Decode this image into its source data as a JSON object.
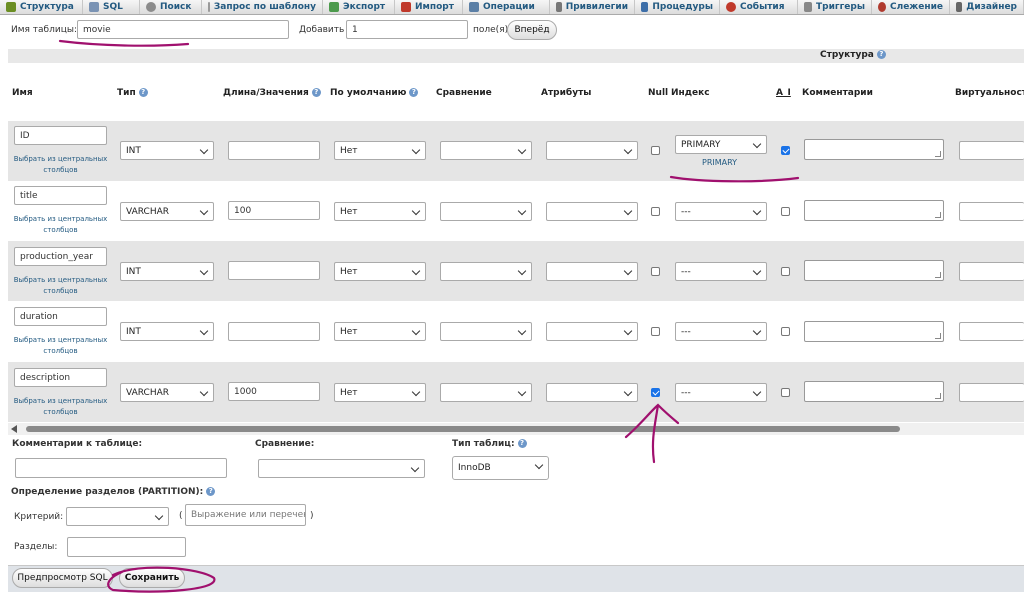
{
  "tabs": [
    {
      "label": "Структура",
      "icon": "structure-icon",
      "color": "#6b8e23"
    },
    {
      "label": "SQL",
      "icon": "sql-icon",
      "color": "#7a93b4"
    },
    {
      "label": "Поиск",
      "icon": "search-icon",
      "color": "#8c8c8c"
    },
    {
      "label": "Запрос по шаблону",
      "icon": "query-icon",
      "color": "#9a9a9a"
    },
    {
      "label": "Экспорт",
      "icon": "export-icon",
      "color": "#4c9a4c"
    },
    {
      "label": "Импорт",
      "icon": "import-icon",
      "color": "#c0392b"
    },
    {
      "label": "Операции",
      "icon": "operations-icon",
      "color": "#5b7fa6"
    },
    {
      "label": "Привилегии",
      "icon": "privileges-icon",
      "color": "#777777"
    },
    {
      "label": "Процедуры",
      "icon": "procedures-icon",
      "color": "#3d6ea8"
    },
    {
      "label": "События",
      "icon": "events-icon",
      "color": "#c0392b"
    },
    {
      "label": "Триггеры",
      "icon": "triggers-icon",
      "color": "#888888"
    },
    {
      "label": "Слежение",
      "icon": "tracking-icon",
      "color": "#b03a2e"
    },
    {
      "label": "Дизайнер",
      "icon": "designer-icon",
      "color": "#666666"
    }
  ],
  "header": {
    "table_name_label": "Имя таблицы:",
    "table_name_value": "movie",
    "add_label": "Добавить",
    "add_count": "1",
    "fields_label": "поле(я)",
    "go_button": "Вперёд"
  },
  "structure_caption": "Структура",
  "columns": {
    "name": "Имя",
    "type": "Тип",
    "length": "Длина/Значения",
    "default": "По умолчанию",
    "collation": "Сравнение",
    "attributes": "Атрибуты",
    "null": "Null",
    "index": "Индекс",
    "ai": "A_I",
    "comments": "Комментарии",
    "virtuality": "Виртуальность"
  },
  "pick_central": "Выбрать из центральных",
  "pick_central_2": "столбцов",
  "rows": [
    {
      "name": "ID",
      "type": "INT",
      "length": "",
      "default": "Нет",
      "null": false,
      "index": "PRIMARY",
      "index_note": "PRIMARY",
      "ai": true
    },
    {
      "name": "title",
      "type": "VARCHAR",
      "length": "100",
      "default": "Нет",
      "null": false,
      "index": "---",
      "index_note": "",
      "ai": false
    },
    {
      "name": "production_year",
      "type": "INT",
      "length": "",
      "default": "Нет",
      "null": false,
      "index": "---",
      "index_note": "",
      "ai": false
    },
    {
      "name": "duration",
      "type": "INT",
      "length": "",
      "default": "Нет",
      "null": false,
      "index": "---",
      "index_note": "",
      "ai": false
    },
    {
      "name": "description",
      "type": "VARCHAR",
      "length": "1000",
      "default": "Нет",
      "null": true,
      "index": "---",
      "index_note": "",
      "ai": false
    }
  ],
  "footer": {
    "table_comments_label": "Комментарии к таблице:",
    "collation_label": "Сравнение:",
    "table_type_label": "Тип таблиц:",
    "table_type_value": "InnoDB",
    "partition_label": "Определение разделов (PARTITION):",
    "criterion_label": "Критерий:",
    "paren_open": "(",
    "expression_placeholder": "Выражение или перечень",
    "paren_close": ")",
    "partitions_label": "Разделы:",
    "preview_button": "Предпросмотр SQL",
    "save_button": "Сохранить"
  },
  "colors": {
    "accent": "#1a73e8",
    "link": "#235a81",
    "row_alt": "#e5e5e5",
    "annotation": "#a0106e"
  }
}
